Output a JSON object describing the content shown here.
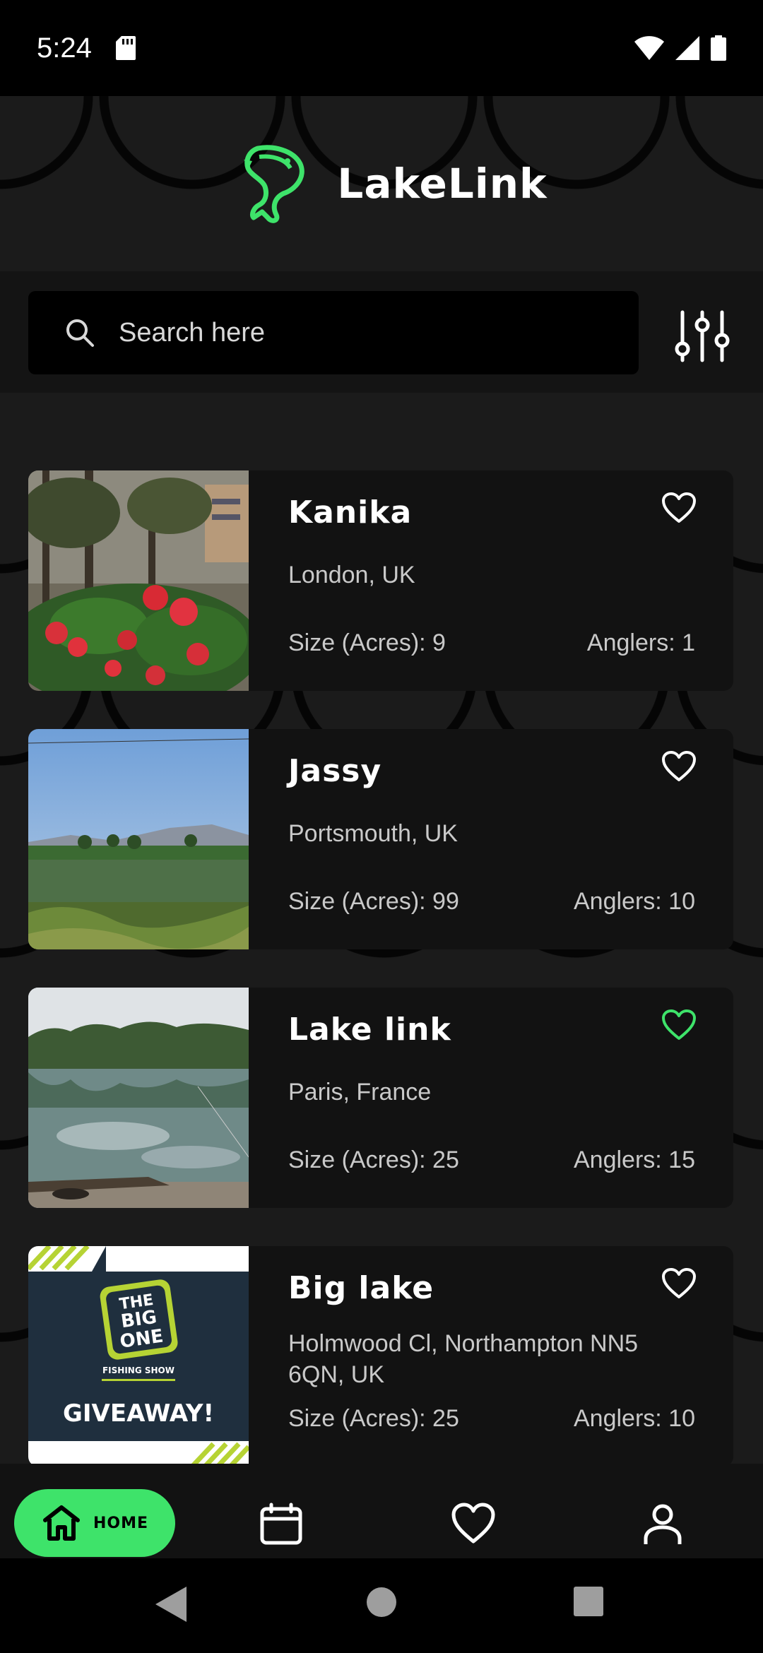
{
  "status": {
    "time": "5:24"
  },
  "app": {
    "name": "LakeLink",
    "accent": "#3ee36a"
  },
  "search": {
    "placeholder": "Search here"
  },
  "lakes": [
    {
      "name": "Kanika",
      "location": "London, UK",
      "size": "Size (Acres): 9",
      "anglers": "Anglers: 1",
      "favorite": false
    },
    {
      "name": "Jassy",
      "location": "Portsmouth, UK",
      "size": "Size (Acres): 99",
      "anglers": "Anglers: 10",
      "favorite": false
    },
    {
      "name": "Lake link",
      "location": "Paris, France",
      "size": "Size (Acres): 25",
      "anglers": "Anglers: 15",
      "favorite": true
    },
    {
      "name": "Big lake",
      "location": "Holmwood Cl, Northampton NN5 6QN, UK",
      "size": "Size (Acres): 25",
      "anglers": "Anglers: 10",
      "favorite": false,
      "image_text": {
        "badge": "THE BIG ONE",
        "sub": "FISHING SHOW",
        "main": "GIVEAWAY!"
      }
    }
  ],
  "bottom_nav": {
    "home_label": "HOME",
    "items": [
      "home-icon",
      "calendar-icon",
      "heart-icon",
      "profile-icon"
    ]
  },
  "icons": [
    "sd-card-icon",
    "wifi-icon",
    "signal-icon",
    "battery-icon",
    "fish-logo-icon",
    "search-icon",
    "filter-icon",
    "heart-icon",
    "back-icon",
    "home-circle-icon",
    "recents-icon"
  ]
}
